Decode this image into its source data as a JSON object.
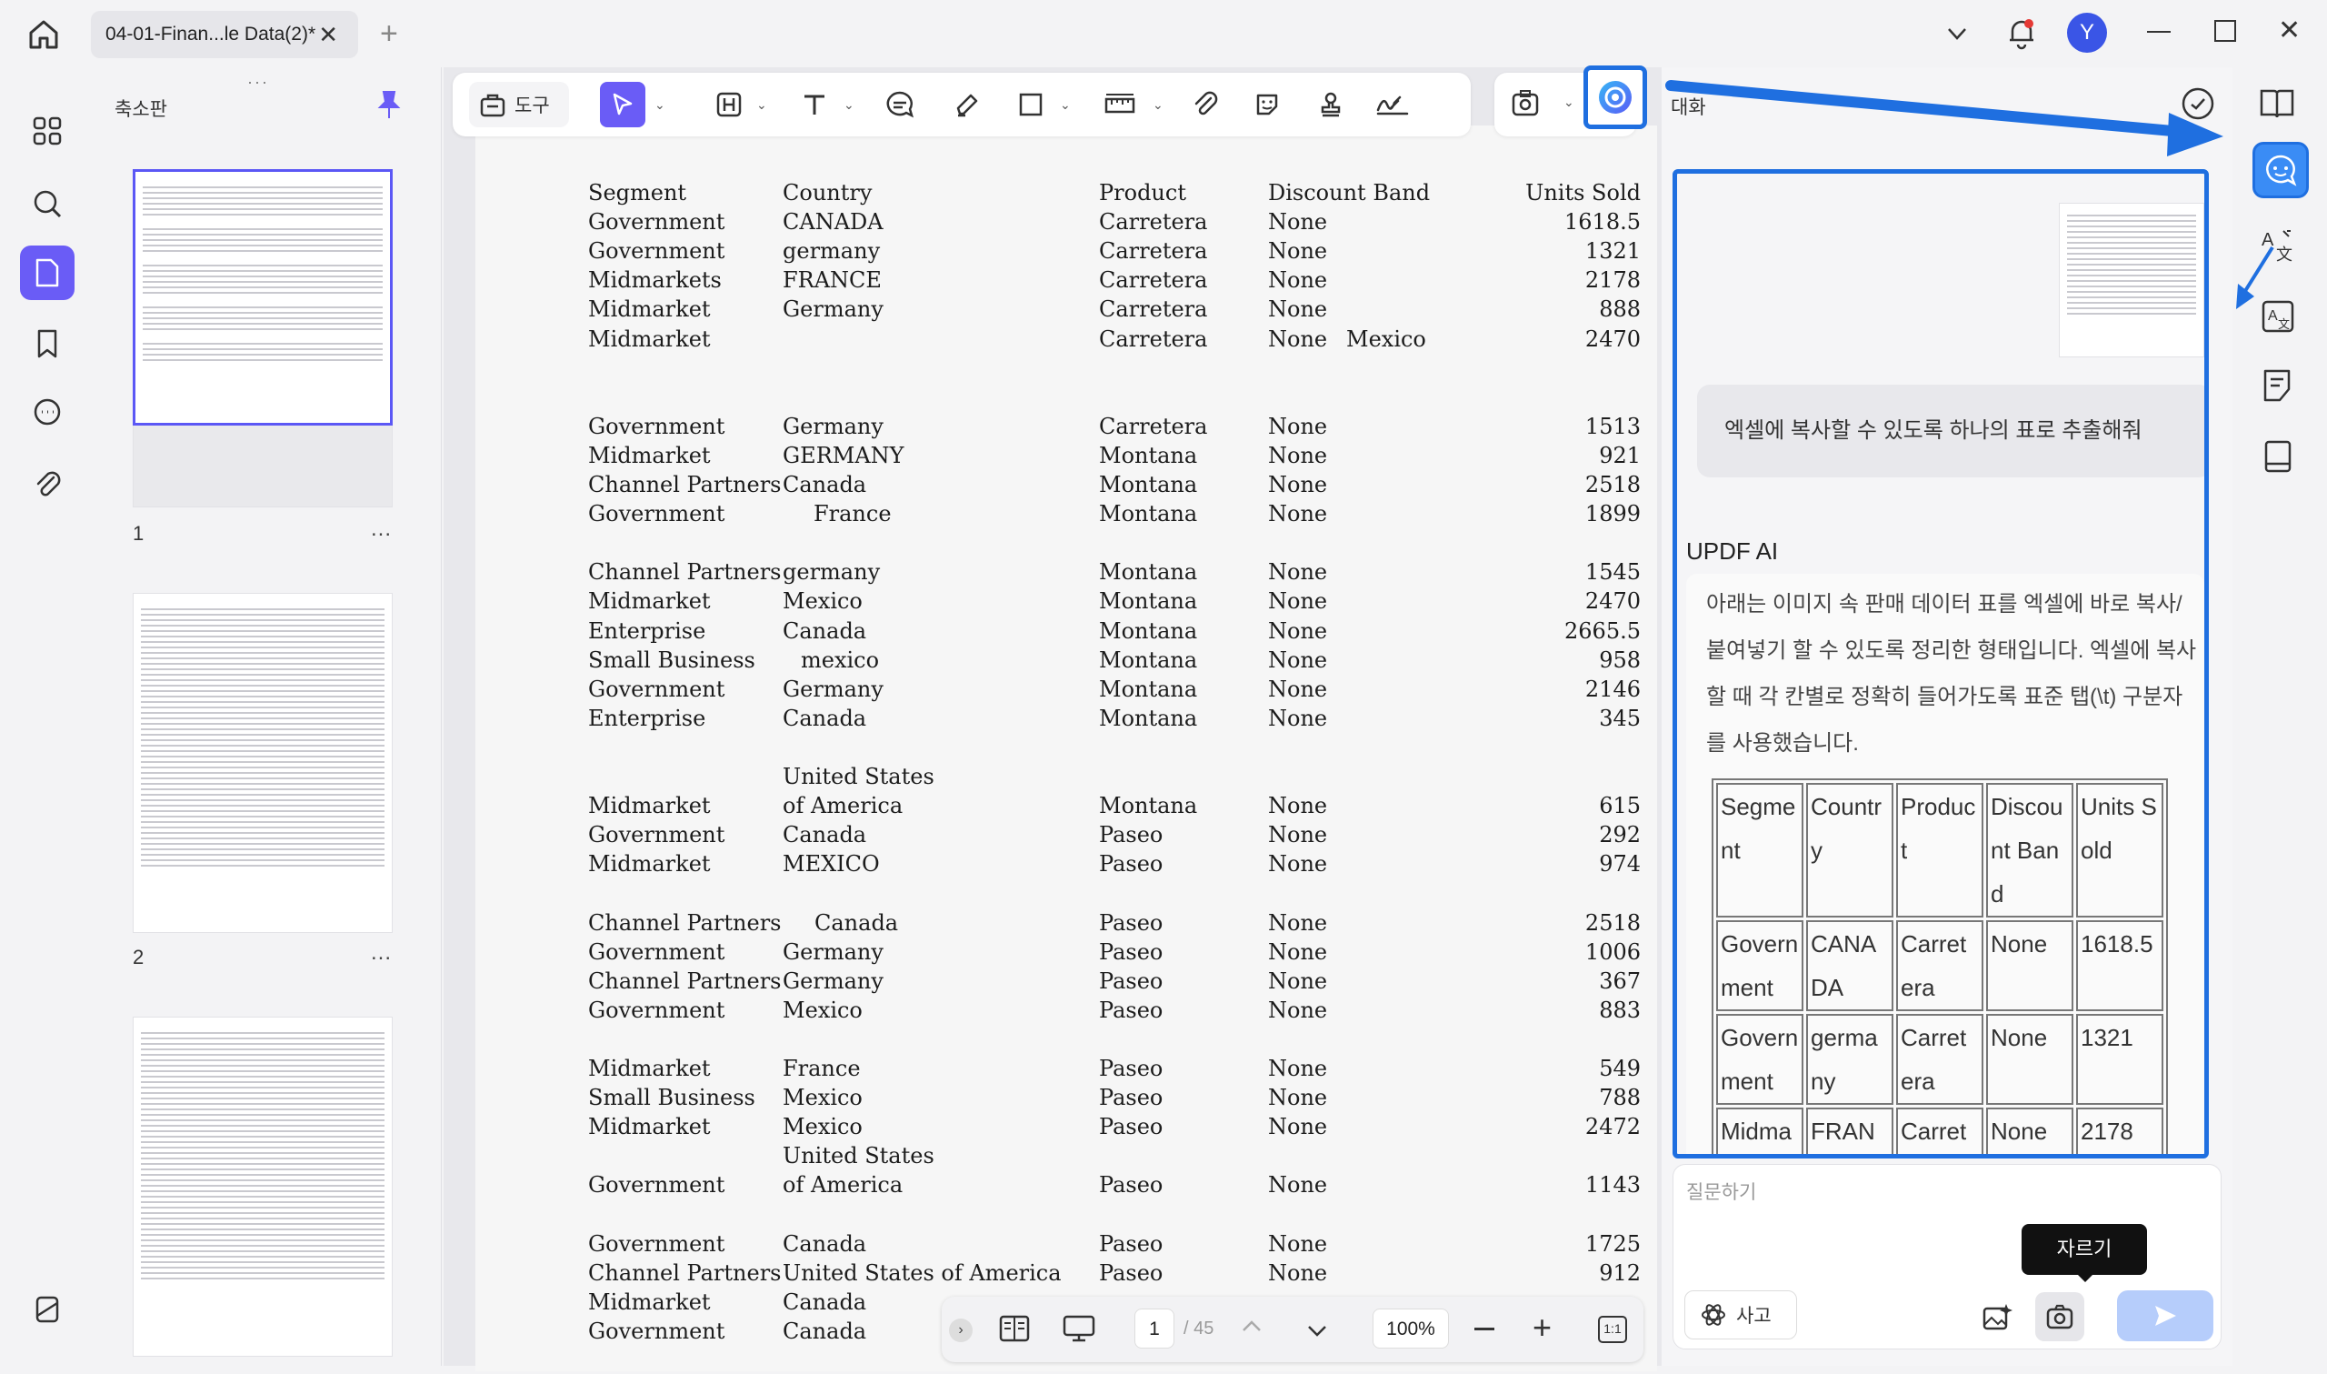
{
  "titlebar": {
    "tab_title": "04-01-Finan...le Data(2)*",
    "avatar_letter": "Y"
  },
  "sidebar": {
    "panel_title": "축소판",
    "pages": [
      {
        "num": "1",
        "more": "..."
      },
      {
        "num": "2",
        "more": "..."
      }
    ]
  },
  "toolbar": {
    "tools_label": "도구"
  },
  "document": {
    "headers": [
      "Segment",
      "Country",
      "Product",
      "Discount Band",
      "Units Sold"
    ],
    "rows": [
      {
        "seg": "Government",
        "country": "CANADA",
        "product": "Carretera",
        "band": "None",
        "units": "1618.5"
      },
      {
        "seg": "Government",
        "country": "germany",
        "product": "Carretera",
        "band": "None",
        "units": "1321"
      },
      {
        "seg": "Midmarkets",
        "country": "FRANCE",
        "product": "Carretera",
        "band": "None",
        "units": "2178"
      },
      {
        "seg": "Midmarket",
        "country": "Germany",
        "product": "Carretera",
        "band": "None",
        "units": "888"
      },
      {
        "seg": "Midmarket",
        "country": "Mexico",
        "product": "Carretera",
        "band": "None",
        "units": "2470"
      },
      {
        "seg": "Government",
        "country": "Germany",
        "product": "Carretera",
        "band": "None",
        "units": "1513"
      },
      {
        "seg": "Midmarket",
        "country": "GERMANY",
        "product": "Montana",
        "band": "None",
        "units": "921"
      },
      {
        "seg": "Channel Partners",
        "country": "Canada",
        "product": "Montana",
        "band": "None",
        "units": "2518"
      },
      {
        "seg": "Government",
        "country": "France",
        "product": "Montana",
        "band": "None",
        "units": "1899"
      },
      {
        "seg": "Channel Partners",
        "country": "germany",
        "product": "Montana",
        "band": "None",
        "units": "1545"
      },
      {
        "seg": "Midmarket",
        "country": "Mexico",
        "product": "Montana",
        "band": "None",
        "units": "2470"
      },
      {
        "seg": "Enterprise",
        "country": "Canada",
        "product": "Montana",
        "band": "None",
        "units": "2665.5"
      },
      {
        "seg": "Small Business",
        "country": "mexico",
        "product": "Montana",
        "band": "None",
        "units": "958"
      },
      {
        "seg": "Government",
        "country": "Germany",
        "product": "Montana",
        "band": "None",
        "units": "2146"
      },
      {
        "seg": "Enterprise",
        "country": "Canada",
        "product": "Montana",
        "band": "None",
        "units": "345"
      },
      {
        "seg": "",
        "country": "United States",
        "product": "",
        "band": "",
        "units": ""
      },
      {
        "seg": "Midmarket",
        "country": "of America",
        "product": "Montana",
        "band": "None",
        "units": "615"
      },
      {
        "seg": "Government",
        "country": "Canada",
        "product": "Paseo",
        "band": "None",
        "units": "292"
      },
      {
        "seg": "Midmarket",
        "country": "MEXICO",
        "product": "Paseo",
        "band": "None",
        "units": "974"
      },
      {
        "seg": "Channel Partners",
        "country": "Canada",
        "product": "Paseo",
        "band": "None",
        "units": "2518"
      },
      {
        "seg": "Government",
        "country": "Germany",
        "product": "Paseo",
        "band": "None",
        "units": "1006"
      },
      {
        "seg": "Channel Partners",
        "country": "Germany",
        "product": "Paseo",
        "band": "None",
        "units": "367"
      },
      {
        "seg": "Government",
        "country": "Mexico",
        "product": "Paseo",
        "band": "None",
        "units": "883"
      },
      {
        "seg": "Midmarket",
        "country": "France",
        "product": "Paseo",
        "band": "None",
        "units": "549"
      },
      {
        "seg": "Small Business",
        "country": "Mexico",
        "product": "Paseo",
        "band": "None",
        "units": "788"
      },
      {
        "seg": "Midmarket",
        "country": "Mexico",
        "product": "Paseo",
        "band": "None",
        "units": "2472"
      },
      {
        "seg": "",
        "country": "United States",
        "product": "",
        "band": "",
        "units": ""
      },
      {
        "seg": "Government",
        "country": "of America",
        "product": "Paseo",
        "band": "None",
        "units": "1143"
      },
      {
        "seg": "Government",
        "country": "Canada",
        "product": "Paseo",
        "band": "None",
        "units": "1725"
      },
      {
        "seg": "Channel Partners",
        "country": "United States of America",
        "product": "Paseo",
        "band": "None",
        "units": "912"
      },
      {
        "seg": "Midmarket",
        "country": "Canada",
        "product": "",
        "band": "",
        "units": ""
      },
      {
        "seg": "Government",
        "country": "Canada",
        "product": "",
        "band": "",
        "units": ""
      }
    ]
  },
  "bottomnav": {
    "page_current": "1",
    "page_total": "/ 45",
    "zoom": "100%",
    "fit_label": "1:1"
  },
  "ai": {
    "tab_label": "대화",
    "user_prompt": "엑셀에 복사할 수 있도록 하나의 표로 추출해줘",
    "assistant_name": "UPDF AI",
    "response_text": "아래는 이미지 속 판매 데이터 표를 엑셀에 바로 복사/붙여넣기 할 수 있도록 정리한 형태입니다. 엑셀에 복사할 때 각 칸별로 정확히 들어가도록 표준 탭(\\t) 구분자를 사용했습니다.",
    "table": {
      "header": [
        "Segment",
        "Country",
        "Product",
        "Discount Band",
        "Units Sold"
      ],
      "rows": [
        [
          "Government",
          "CANADA",
          "Carretera",
          "None",
          "1618.5"
        ],
        [
          "Government",
          "germany",
          "Carretera",
          "None",
          "1321"
        ],
        [
          "Midmarkets",
          "FRANCE",
          "Carretera",
          "None",
          "2178"
        ]
      ]
    },
    "input_placeholder": "질문하기",
    "think_label": "사고",
    "tooltip": "자르기"
  },
  "colors": {
    "accent": "#6a5cf6",
    "highlight_blue": "#1f6fe0"
  }
}
